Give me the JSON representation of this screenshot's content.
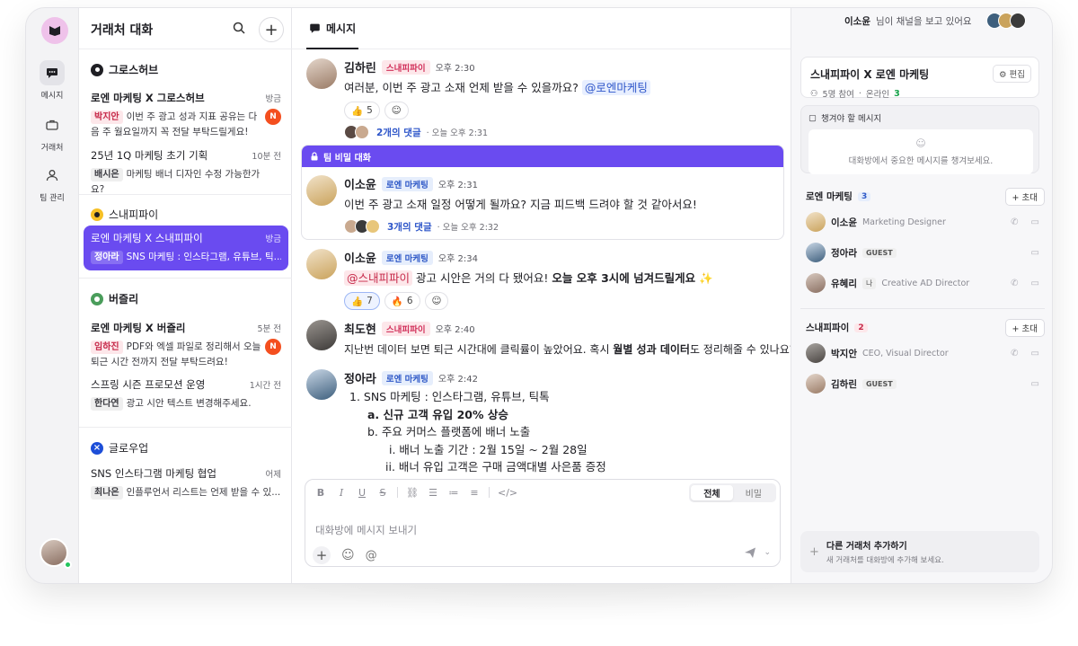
{
  "rail": {
    "items": [
      {
        "label": "메시지",
        "icon": "chat-bubble-icon",
        "active": true
      },
      {
        "label": "거래처",
        "icon": "briefcase-icon",
        "active": false
      },
      {
        "label": "팀 관리",
        "icon": "person-icon",
        "active": false
      }
    ]
  },
  "convlist": {
    "title": "거래처 대화",
    "groups": [
      {
        "name": "그로스허브",
        "conversations": [
          {
            "name": "로엔 마케팅 X 그로스허브",
            "time": "방금",
            "sender": "박지안",
            "message": "이번 주 광고 성과 지표 공유는 다음 주 월요일까지 꼭 전달 부탁드릴게요!",
            "badge": "N"
          },
          {
            "name": "25년 1Q 마케팅 초기 기획",
            "time": "10분 전",
            "sender": "배시은",
            "message": "마케팅 배너 디자인 수정 가능한가요?"
          }
        ]
      },
      {
        "name": "스내피파이",
        "conversations": [
          {
            "name": "로엔 마케팅 X 스내피파이",
            "time": "방금",
            "sender": "정아라",
            "message": "SNS 마케팅 : 인스타그램, 유튜브, 틱..."
          }
        ]
      },
      {
        "name": "버즐리",
        "conversations": [
          {
            "name": "로엔 마케팅 X 버즐리",
            "time": "5분 전",
            "sender": "임하진",
            "message": "PDF와 엑셀 파일로 정리해서 오늘 퇴근 시간 전까지 전달 부탁드려요!",
            "badge": "N"
          },
          {
            "name": "스프링 시즌 프로모션 운영",
            "time": "1시간 전",
            "sender": "한다연",
            "message": "광고 시안 텍스트 변경해주세요."
          }
        ]
      },
      {
        "name": "글로우업",
        "conversations": [
          {
            "name": "SNS 인스타그램 마케팅 협업",
            "time": "어제",
            "sender": "최나은",
            "message": "인플루언서 리스트는 언제 받을 수 있..."
          }
        ]
      }
    ]
  },
  "chat": {
    "tab": "메시지",
    "viewing_name": "이소윤",
    "viewing_suffix": "님이 채널을 보고 있어요",
    "messages": [
      {
        "name": "김하린",
        "tag": "스내피파이",
        "time": "오후 2:30",
        "text": "여러분, 이번 주 광고 소재 언제 받을 수 있을까요?",
        "mention": "@로엔마케팅",
        "reaction_emoji": "👍",
        "reaction_count": "5",
        "thread_label": "2개의 댓글",
        "thread_time": "· 오늘 오후 2:31"
      },
      {
        "name": "이소윤",
        "tag": "로엔 마케팅",
        "time": "오후 2:31",
        "text": "이번 주 광고 소재 일정 어떻게 될까요? 지금 피드백 드려야 할 것 같아서요!",
        "thread_label": "3개의 댓글",
        "thread_time": "· 오늘 오후 2:32"
      },
      {
        "name": "이소윤",
        "tag": "로엔 마케팅",
        "time": "오후 2:34",
        "mention": "@스내피파이",
        "text_plain": " 광고 시안은 거의 다 됐어요! ",
        "text_bold": "오늘 오후 3시에 넘겨드릴게요",
        "sparkle": "✨",
        "reactions": [
          {
            "emoji": "👍",
            "count": "7"
          },
          {
            "emoji": "🔥",
            "count": "6"
          }
        ]
      },
      {
        "name": "최도현",
        "tag": "스내피파이",
        "time": "오후 2:40",
        "text_plain": "지난번 데이터 보면 퇴근 시간대에 클릭률이 높았어요. 혹시 ",
        "text_bold": "월별 성과 데이터",
        "text_end": "도 정리해줄 수 있나요?"
      },
      {
        "name": "정아라",
        "tag": "로엔 마케팅",
        "time": "오후 2:42",
        "lines": [
          "1.  SNS 마케팅 : 인스타그램, 유튜브, 틱톡",
          "a.  신규 고객 유입 20% 상승",
          "b.  주요 커머스 플랫폼에 배너 노출",
          "i.  배너 노출 기간 : 2월 15일 ~ 2월 28일",
          "ii.  배너 유입 고객은 구매 금액대별 사은품 증정"
        ]
      }
    ],
    "secret_label": "팀 비밀 대화",
    "composer": {
      "placeholder": "대화방에 메시지 보내기",
      "seg_all": "전체",
      "seg_secret": "비밀"
    }
  },
  "rpanel": {
    "channel_title": "스내피파이 X 로엔 마케팅",
    "edit_label": "편집",
    "participants": "5명 참여",
    "online_label": "온라인",
    "online_count": "3",
    "pinned_title": "챙겨야 할 메시지",
    "pinned_empty": "대화방에서 중요한 메시지를 챙겨보세요.",
    "invite_label": "초대",
    "teams": [
      {
        "name": "로엔 마케팅",
        "count": "3",
        "members": [
          {
            "name": "이소윤",
            "role": "Marketing Designer"
          },
          {
            "name": "정아라",
            "badge": "GUEST"
          },
          {
            "name": "유혜리",
            "me": "나",
            "role": "Creative AD Director"
          }
        ]
      },
      {
        "name": "스내피파이",
        "count": "2",
        "members": [
          {
            "name": "박지안",
            "role": "CEO, Visual Director"
          },
          {
            "name": "김하린",
            "badge": "GUEST"
          }
        ]
      }
    ],
    "add_partner_title": "다른 거래처 추가하기",
    "add_partner_sub": "새 거래처를 대화방에 추가해 보세요."
  },
  "colors": {
    "accent": "#6a4bf0",
    "badge": "#f44f1f",
    "online": "#22c55e"
  }
}
